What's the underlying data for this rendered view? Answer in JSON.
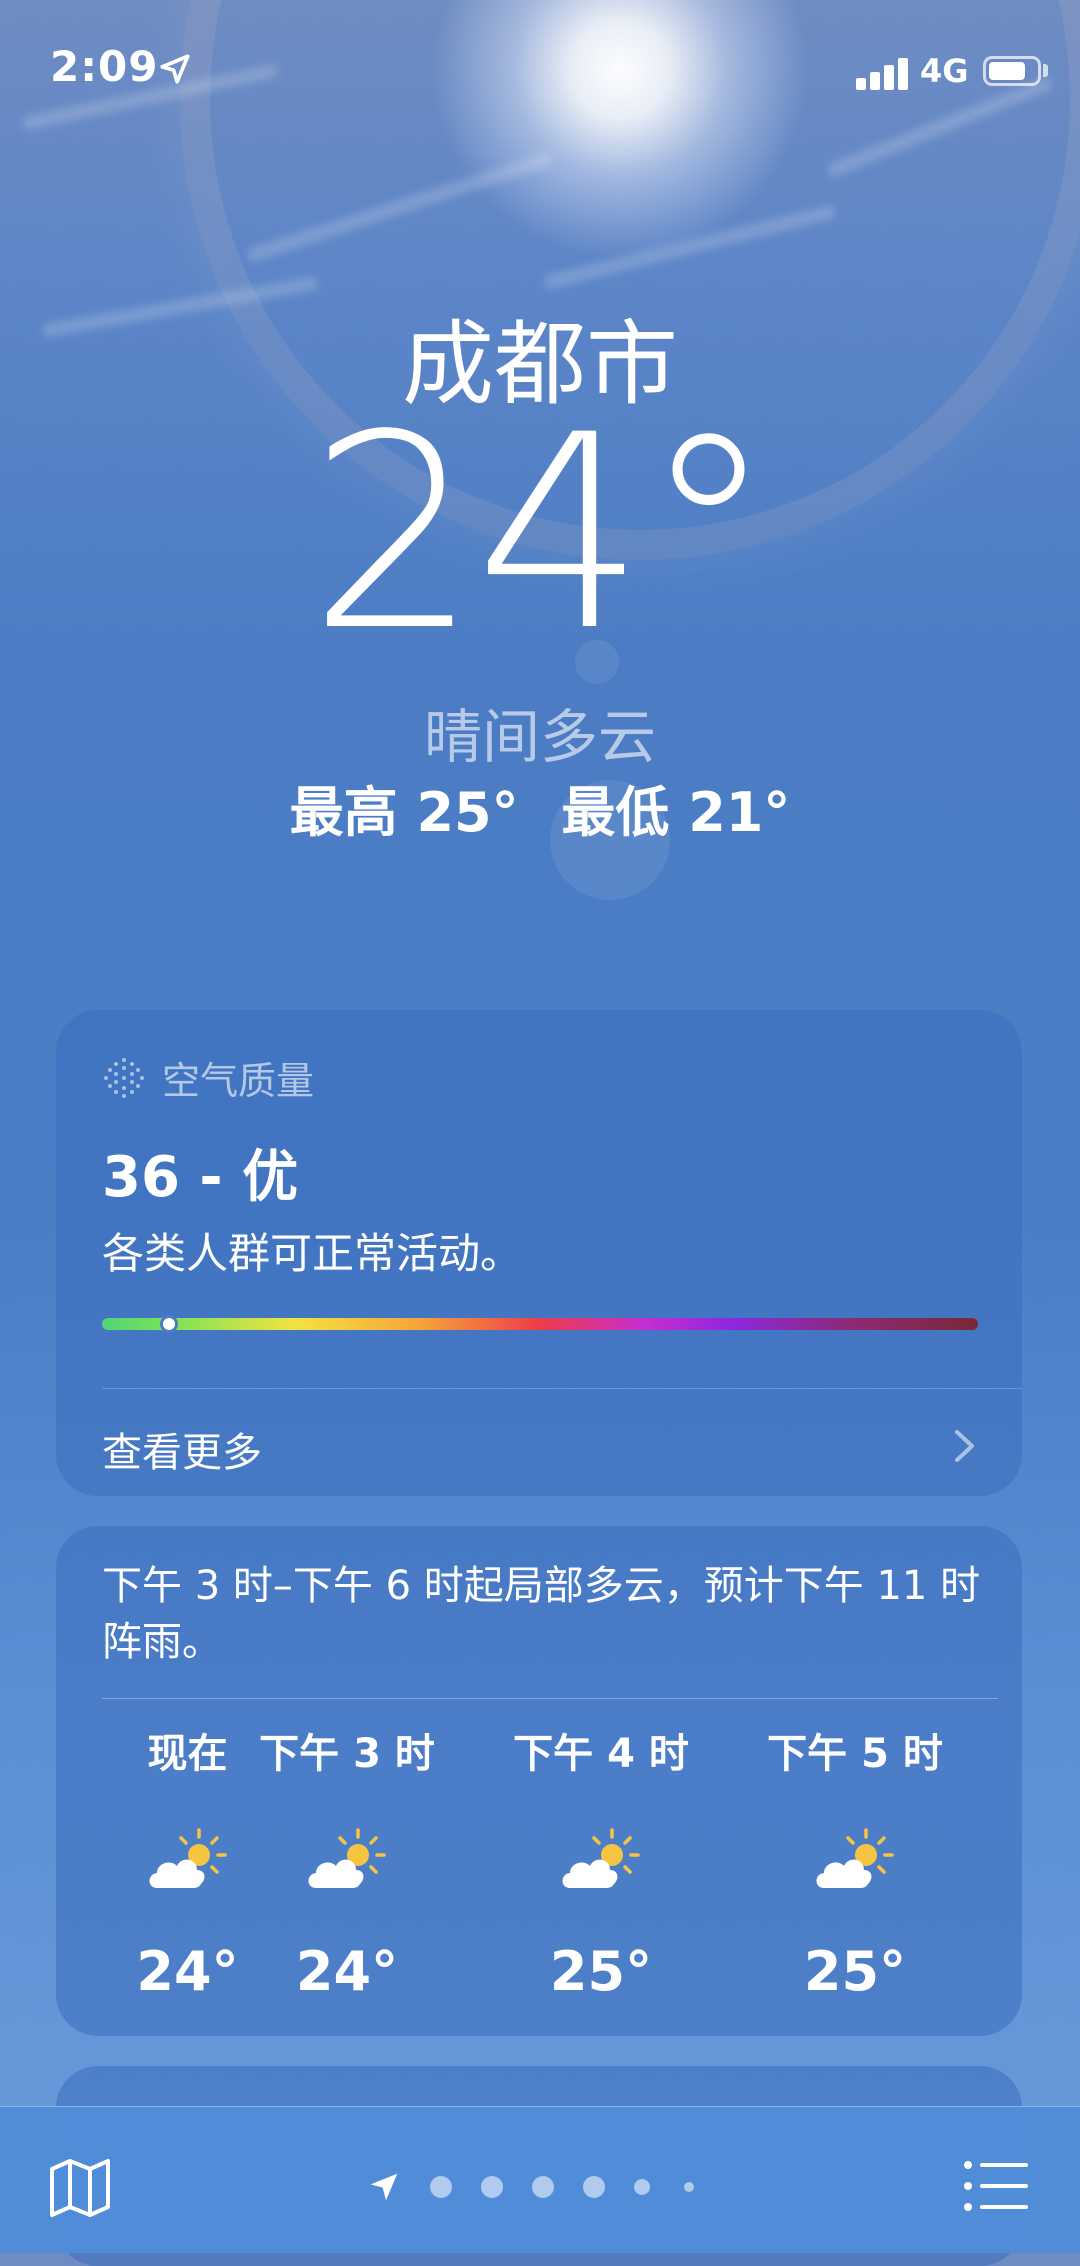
{
  "status_bar": {
    "time": "2:09",
    "network": "4G"
  },
  "header": {
    "city": "成都市",
    "temperature": "24°",
    "condition": "晴间多云",
    "high": "最高 25°",
    "low": "最低 21°"
  },
  "air_quality": {
    "label": "空气质量",
    "value": "36 - 优",
    "description": "各类人群可正常活动。",
    "scale_position": 0.077,
    "see_more": "查看更多"
  },
  "hourly": {
    "summary": "下午 3 时–下午 6 时起局部多云，预计下午 11 时阵雨。",
    "items": [
      {
        "label": "现在",
        "icon": "partly-cloudy-icon",
        "temp": "24°"
      },
      {
        "label": "下午 3 时",
        "icon": "partly-cloudy-icon",
        "temp": "24°"
      },
      {
        "label": "下午 4 时",
        "icon": "partly-cloudy-icon",
        "temp": "25°"
      },
      {
        "label": "下午 5 时",
        "icon": "partly-cloudy-icon",
        "temp": "25°"
      }
    ]
  },
  "toolbar": {
    "map_icon": "map-icon",
    "list_icon": "list-icon",
    "page_count": 6,
    "current_page": 0
  },
  "colors": {
    "sky": "#4a7fc6",
    "card": "#3c6ebe",
    "sun": "#f5c542",
    "aqi_indicator": "#ffffff"
  }
}
